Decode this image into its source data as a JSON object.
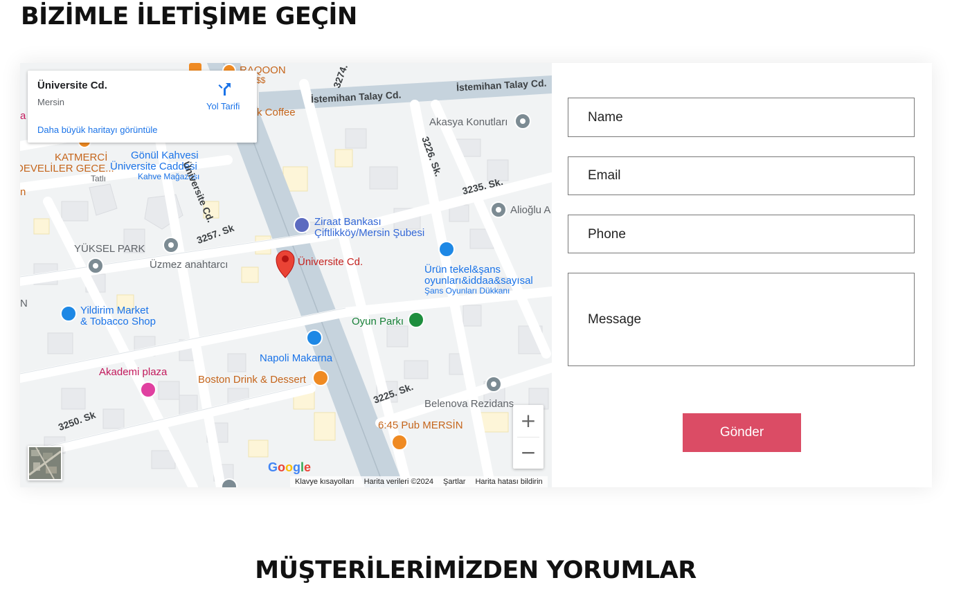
{
  "page": {
    "title": "BİZİMLE İLETİŞİME GEÇİN",
    "section_title": "MÜŞTERİLERİMİZDEN YORUMLAR"
  },
  "map": {
    "info_card": {
      "title": "Üniversite Cd.",
      "subtitle": "Mersin",
      "directions_label": "Yol Tarifi",
      "larger_map_link": "Daha büyük haritayı görüntüle"
    },
    "labels": {
      "raqoon": "RAQOON",
      "raqoon_sub": "pa · $$",
      "coffee": "k Coffee",
      "istemihan_1": "İstemihan Talay Cd.",
      "istemihan_2": "İstemihan Talay Cd.",
      "street_3274": "3274.",
      "akasya": "Akasya Konutları",
      "street_3226": "3226. Sk.",
      "gonul": "Gönül Kahvesi",
      "universite_caddesi": "Üniversite Caddesi",
      "kahve_magazasi": "Kahve Mağazası",
      "katmerci": "KATMERCİ",
      "develiler": "DEVELİLER GECE...",
      "tatli": "Tatlı",
      "universite_road": "Üniversite Cd.",
      "street_3235": "3235. Sk.",
      "alioglu": "Alioğlu A",
      "ziraat_1": "Ziraat Bankası",
      "ziraat_2": "Çiftlikköy/Mersin Şubesi",
      "street_3257": "3257. Sk",
      "yuksel": "YÜKSEL PARK",
      "uzmez": "Üzmez anahtarcı",
      "pin_label": "Üniversite Cd.",
      "urun_1": "Ürün tekel&şans",
      "urun_2": "oyunları&iddaa&sayısal",
      "urun_3": "Şans Oyunları Dükkanı",
      "yildirim_1": "Yildirim Market",
      "yildirim_2": "& Tobacco Shop",
      "oyun_parki": "Oyun Parkı",
      "napoli": "Napoli Makarna",
      "akademi": "Akademi plaza",
      "boston": "Boston Drink & Dessert",
      "street_3225": "3225. Sk.",
      "belenova": "Belenova Rezidans",
      "street_3250": "3250. Sk",
      "pub": "6:45 Pub MERSİN",
      "edge_n": "N",
      "edge_a": "a",
      "edge_n2": "n"
    },
    "google_logo": "Google",
    "attribution": [
      "Klavye kısayolları",
      "Harita verileri ©2024",
      "Şartlar",
      "Harita hatası bildirin"
    ],
    "zoom_in": "+",
    "zoom_out": "−"
  },
  "form": {
    "name_placeholder": "Name",
    "email_placeholder": "Email",
    "phone_placeholder": "Phone",
    "message_placeholder": "Message",
    "submit_label": "Gönder"
  },
  "colors": {
    "accent": "#db4c65",
    "map_bg": "#f1f3f4",
    "link_blue": "#1a73e8"
  }
}
